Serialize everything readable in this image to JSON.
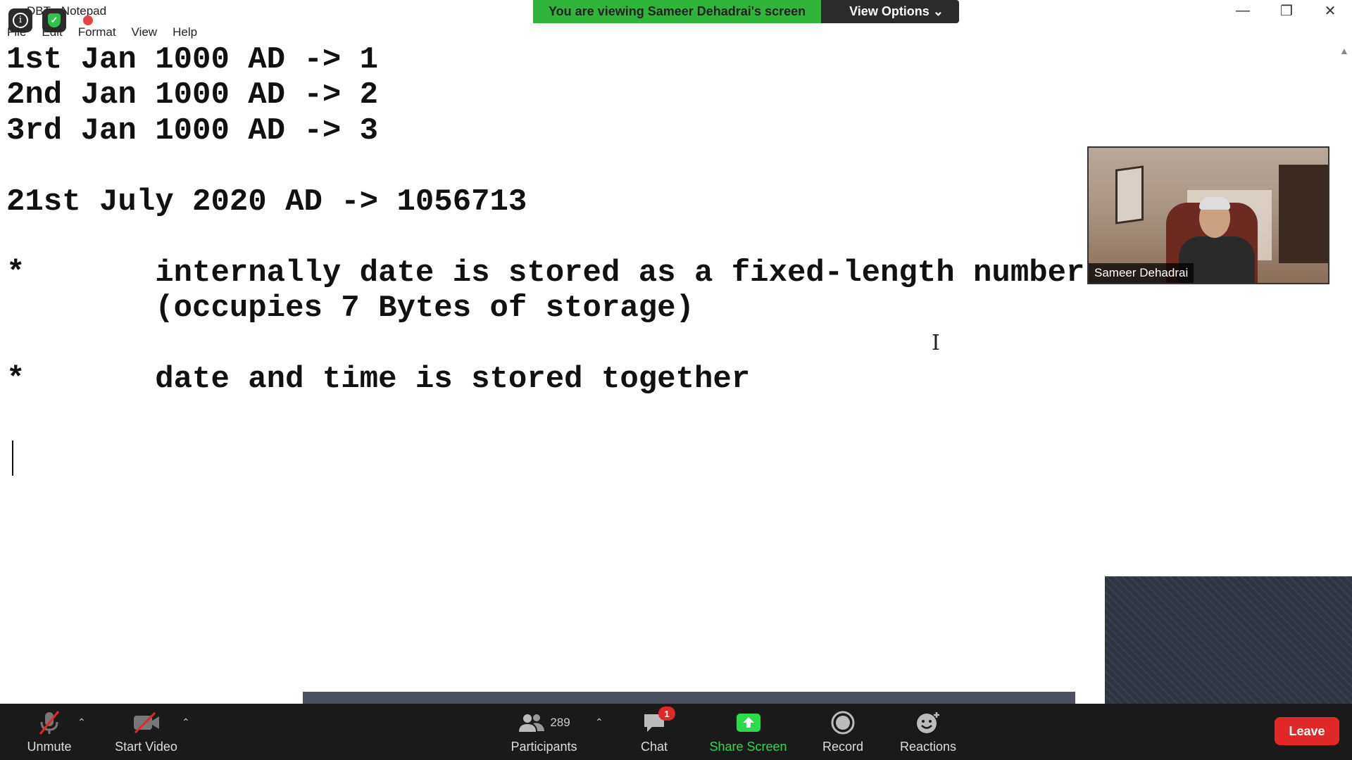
{
  "window": {
    "title": "DBT - Notepad",
    "controls": {
      "minimize": "—",
      "restore": "❐",
      "close": "✕"
    }
  },
  "menu": [
    "File",
    "Edit",
    "Format",
    "View",
    "Help"
  ],
  "banner": {
    "text": "You are viewing Sameer Dehadrai's screen",
    "view_options": "View Options ⌄",
    "accent": "#2fb539"
  },
  "editor": {
    "lines": [
      "1st Jan 1000 AD -> 1",
      "2nd Jan 1000 AD -> 2",
      "3rd Jan 1000 AD -> 3",
      "21st July 2020 AD -> 1056713",
      "*       internally date is stored as a fixed-length number",
      "        (occupies 7 Bytes of storage)",
      "*       date and time is stored together"
    ]
  },
  "video": {
    "participant_name": "Sameer Dehadrai"
  },
  "toolbar": {
    "unmute": "Unmute",
    "start_video": "Start Video",
    "participants": "Participants",
    "participants_count": "289",
    "chat": "Chat",
    "chat_badge": "1",
    "share_screen": "Share Screen",
    "record": "Record",
    "reactions": "Reactions",
    "leave": "Leave",
    "share_color": "#2bdc4a",
    "leave_color": "#e02828"
  }
}
